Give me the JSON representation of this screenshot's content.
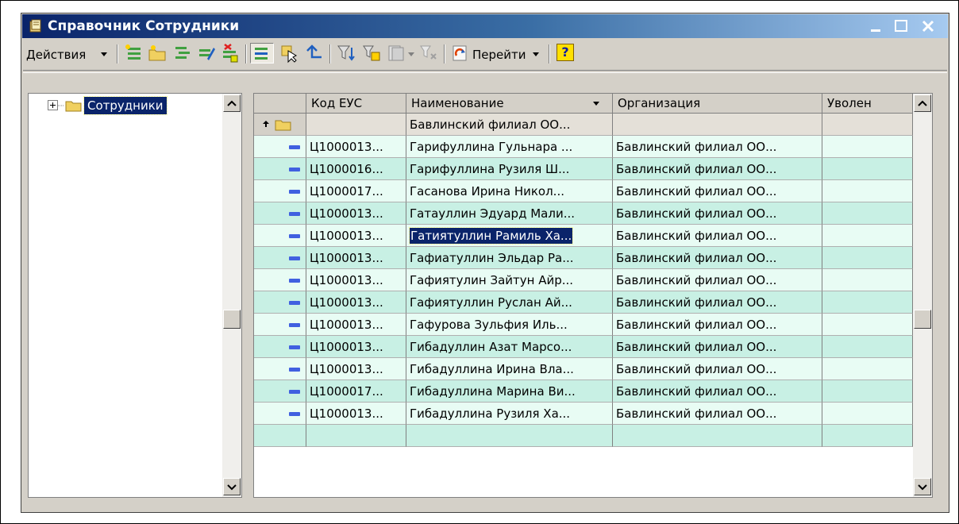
{
  "window": {
    "title": "Справочник Сотрудники",
    "title_icon": "catalog-book-icon"
  },
  "toolbar": {
    "actions_label": "Действия",
    "goto_label": "Перейти",
    "help_label": "?"
  },
  "tree": {
    "root_label": "Сотрудники"
  },
  "grid": {
    "columns": [
      "Код ЕУС",
      "Наименование",
      "Организация",
      "Уволен"
    ],
    "sort_column": "Наименование",
    "group_row_name": "Бавлинский филиал ОО...",
    "rows": [
      {
        "code": "Ц1000013...",
        "name": "Гарифуллина Гульнара ...",
        "org": "Бавлинский филиал ОО...",
        "fired": ""
      },
      {
        "code": "Ц1000016...",
        "name": "Гарифуллина Рузиля Ш...",
        "org": "Бавлинский филиал ОО...",
        "fired": ""
      },
      {
        "code": "Ц1000017...",
        "name": "Гасанова Ирина Никол...",
        "org": "Бавлинский филиал ОО...",
        "fired": ""
      },
      {
        "code": "Ц1000013...",
        "name": "Гатауллин Эдуард Мали...",
        "org": "Бавлинский филиал ОО...",
        "fired": ""
      },
      {
        "code": "Ц1000013...",
        "name": "Гатиятуллин Рамиль Ха...",
        "org": "Бавлинский филиал ОО...",
        "fired": ""
      },
      {
        "code": "Ц1000013...",
        "name": "Гафиатуллин Эльдар Ра...",
        "org": "Бавлинский филиал ОО...",
        "fired": ""
      },
      {
        "code": "Ц1000013...",
        "name": "Гафиятулин Зайтун Айр...",
        "org": "Бавлинский филиал ОО...",
        "fired": ""
      },
      {
        "code": "Ц1000013...",
        "name": "Гафиятуллин Руслан Ай...",
        "org": "Бавлинский филиал ОО...",
        "fired": ""
      },
      {
        "code": "Ц1000013...",
        "name": "Гафурова Зульфия Иль...",
        "org": "Бавлинский филиал ОО...",
        "fired": ""
      },
      {
        "code": "Ц1000013...",
        "name": "Гибадуллин Азат Марсо...",
        "org": "Бавлинский филиал ОО...",
        "fired": ""
      },
      {
        "code": "Ц1000013...",
        "name": "Гибадуллина Ирина Вла...",
        "org": "Бавлинский филиал ОО...",
        "fired": ""
      },
      {
        "code": "Ц1000017...",
        "name": "Гибадуллина Марина Ви...",
        "org": "Бавлинский филиал ОО...",
        "fired": ""
      },
      {
        "code": "Ц1000013...",
        "name": "Гибадуллина Рузиля Ха...",
        "org": "Бавлинский филиал ОО...",
        "fired": ""
      }
    ],
    "selected_row": 5,
    "colors": {
      "row_even": "#e8fcf4",
      "row_odd": "#c8f0e4",
      "selection": "#0a246a"
    }
  }
}
